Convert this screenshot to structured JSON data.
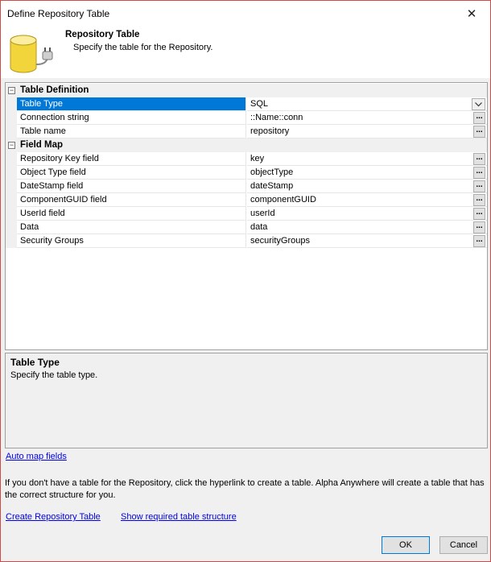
{
  "window": {
    "title": "Define Repository Table",
    "close_glyph": "✕"
  },
  "header": {
    "title": "Repository Table",
    "subtitle": "Specify the table for the Repository.",
    "icon": "database-plug-icon"
  },
  "grid": {
    "categories": [
      {
        "label": "Table Definition",
        "toggle": "−"
      },
      {
        "label": "Field Map",
        "toggle": "−"
      }
    ],
    "table_definition": [
      {
        "name": "Table Type",
        "value": "SQL"
      },
      {
        "name": "Connection string",
        "value": "::Name::conn"
      },
      {
        "name": "Table name",
        "value": "repository"
      }
    ],
    "field_map": [
      {
        "name": "Repository Key field",
        "value": "key"
      },
      {
        "name": "Object Type field",
        "value": "objectType"
      },
      {
        "name": "DateStamp field",
        "value": "dateStamp"
      },
      {
        "name": "ComponentGUID field",
        "value": "componentGUID"
      },
      {
        "name": "UserId field",
        "value": "userId"
      },
      {
        "name": "Data",
        "value": "data"
      },
      {
        "name": "Security Groups",
        "value": "securityGroups"
      }
    ],
    "ellipsis_label": "..."
  },
  "description": {
    "title": "Table Type",
    "text": "Specify the table type."
  },
  "links": {
    "auto_map": "Auto map fields",
    "create": "Create Repository Table",
    "show_structure": "Show required table structure"
  },
  "info_text": "If you don't have a table for the Repository, click the hyperlink to create a table. Alpha Anywhere will create a table that has the correct structure for you.",
  "buttons": {
    "ok": "OK",
    "cancel": "Cancel"
  },
  "colors": {
    "selection": "#0078d7",
    "link": "#0000ee",
    "window_border": "#d04a4a"
  }
}
